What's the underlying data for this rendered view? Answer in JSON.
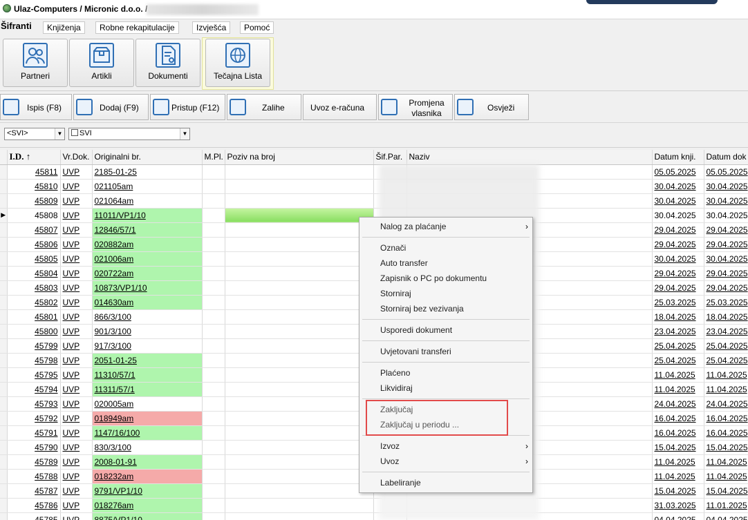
{
  "window": {
    "title": "Ulaz-Computers / Micronic d.o.o. /"
  },
  "menu": {
    "tabs": [
      "Šifranti",
      "Knjiženja",
      "Robne rekapitulacije",
      "Izvješća",
      "Pomoć"
    ]
  },
  "ribbon": {
    "buttons": [
      "Partneri",
      "Artikli",
      "Dokumenti",
      "Tečajna Lista"
    ]
  },
  "toolbar": {
    "print": "Ispis (F8)",
    "add": "Dodaj (F9)",
    "access": "Pristup (F12)",
    "stock": "Zalihe",
    "import_invoice": "Uvoz e-računa",
    "change_owner": "Promjena vlasnika",
    "refresh": "Osvježi"
  },
  "filters": {
    "first": "<SVI>",
    "second": "SVI"
  },
  "grid": {
    "columns": [
      "I.D. ↑",
      "Vr.Dok.",
      "Originalni br.",
      "M.Pl.",
      "Poziv na broj",
      "Šif.Par.",
      "Naziv",
      "Datum knji.",
      "Datum dok"
    ],
    "rows": [
      {
        "id": "45811",
        "vr": "UVP",
        "orig": "2185-01-25",
        "hl": "",
        "dk": "05.05.2025",
        "dd": "05.05.2025"
      },
      {
        "id": "45810",
        "vr": "UVP",
        "orig": "021105am",
        "hl": "",
        "dk": "30.04.2025",
        "dd": "30.04.2025"
      },
      {
        "id": "45809",
        "vr": "UVP",
        "orig": "021064am",
        "hl": "",
        "dk": "30.04.2025",
        "dd": "30.04.2025"
      },
      {
        "id": "45808",
        "vr": "UVP",
        "orig": "11011/VP1/10",
        "hl": "green",
        "dk": "30.04.2025",
        "dd": "30.04.2025"
      },
      {
        "id": "45807",
        "vr": "UVP",
        "orig": "12846/57/1",
        "hl": "green",
        "dk": "29.04.2025",
        "dd": "29.04.2025"
      },
      {
        "id": "45806",
        "vr": "UVP",
        "orig": "020882am",
        "hl": "green",
        "dk": "29.04.2025",
        "dd": "29.04.2025"
      },
      {
        "id": "45805",
        "vr": "UVP",
        "orig": "021006am",
        "hl": "green",
        "dk": "30.04.2025",
        "dd": "30.04.2025"
      },
      {
        "id": "45804",
        "vr": "UVP",
        "orig": "020722am",
        "hl": "green",
        "dk": "29.04.2025",
        "dd": "29.04.2025"
      },
      {
        "id": "45803",
        "vr": "UVP",
        "orig": "10873/VP1/10",
        "hl": "green",
        "dk": "29.04.2025",
        "dd": "29.04.2025"
      },
      {
        "id": "45802",
        "vr": "UVP",
        "orig": "014630am",
        "hl": "green",
        "dk": "25.03.2025",
        "dd": "25.03.2025"
      },
      {
        "id": "45801",
        "vr": "UVP",
        "orig": "866/3/100",
        "hl": "",
        "dk": "18.04.2025",
        "dd": "18.04.2025"
      },
      {
        "id": "45800",
        "vr": "UVP",
        "orig": "901/3/100",
        "hl": "",
        "dk": "23.04.2025",
        "dd": "23.04.2025"
      },
      {
        "id": "45799",
        "vr": "UVP",
        "orig": "917/3/100",
        "hl": "",
        "dk": "25.04.2025",
        "dd": "25.04.2025"
      },
      {
        "id": "45798",
        "vr": "UVP",
        "orig": "2051-01-25",
        "hl": "green",
        "dk": "25.04.2025",
        "dd": "25.04.2025"
      },
      {
        "id": "45795",
        "vr": "UVP",
        "orig": "11310/57/1",
        "hl": "green",
        "dk": "11.04.2025",
        "dd": "11.04.2025"
      },
      {
        "id": "45794",
        "vr": "UVP",
        "orig": "11311/57/1",
        "hl": "green",
        "dk": "11.04.2025",
        "dd": "11.04.2025"
      },
      {
        "id": "45793",
        "vr": "UVP",
        "orig": "020005am",
        "hl": "",
        "dk": "24.04.2025",
        "dd": "24.04.2025"
      },
      {
        "id": "45792",
        "vr": "UVP",
        "orig": "018949am",
        "hl": "red",
        "dk": "16.04.2025",
        "dd": "16.04.2025"
      },
      {
        "id": "45791",
        "vr": "UVP",
        "orig": "1147/16/100",
        "hl": "green",
        "dk": "16.04.2025",
        "dd": "16.04.2025"
      },
      {
        "id": "45790",
        "vr": "UVP",
        "orig": "830/3/100",
        "hl": "",
        "dk": "15.04.2025",
        "dd": "15.04.2025"
      },
      {
        "id": "45789",
        "vr": "UVP",
        "orig": "2008-01-91",
        "hl": "green",
        "dk": "11.04.2025",
        "dd": "11.04.2025"
      },
      {
        "id": "45788",
        "vr": "UVP",
        "orig": "018232am",
        "hl": "red",
        "dk": "11.04.2025",
        "dd": "11.04.2025"
      },
      {
        "id": "45787",
        "vr": "UVP",
        "orig": "9791/VP1/10",
        "hl": "green",
        "dk": "15.04.2025",
        "dd": "15.04.2025"
      },
      {
        "id": "45786",
        "vr": "UVP",
        "orig": "018276am",
        "hl": "green",
        "dk": "31.03.2025",
        "dd": "11.01.2025"
      },
      {
        "id": "45785",
        "vr": "UVP",
        "orig": "8875/VP1/10",
        "hl": "green",
        "dk": "04.04.2025",
        "dd": "04.04.2025"
      }
    ]
  },
  "context_menu": {
    "items": [
      {
        "label": "Nalog za plaćanje",
        "submenu": true
      },
      {
        "label": "Označi"
      },
      {
        "label": "Auto transfer"
      },
      {
        "label": "Zapisnik o PC po dokumentu"
      },
      {
        "label": "Storniraj"
      },
      {
        "label": "Storniraj bez vezivanja"
      },
      {
        "label": "Usporedi dokument"
      },
      {
        "label": "Uvjetovani transferi"
      },
      {
        "label": "Plaćeno"
      },
      {
        "label": "Likvidiraj"
      },
      {
        "label": "Zaključaj"
      },
      {
        "label": "Zaključaj u periodu ..."
      },
      {
        "label": "Izvoz",
        "submenu": true
      },
      {
        "label": "Uvoz",
        "submenu": true
      },
      {
        "label": "Labeliranje"
      }
    ]
  },
  "colors": {
    "green_highlight": "#aff5ad",
    "red_highlight": "#f5aaa9",
    "annotation_box": "#e24a4a",
    "icon_blue": "#2f6fb4"
  }
}
